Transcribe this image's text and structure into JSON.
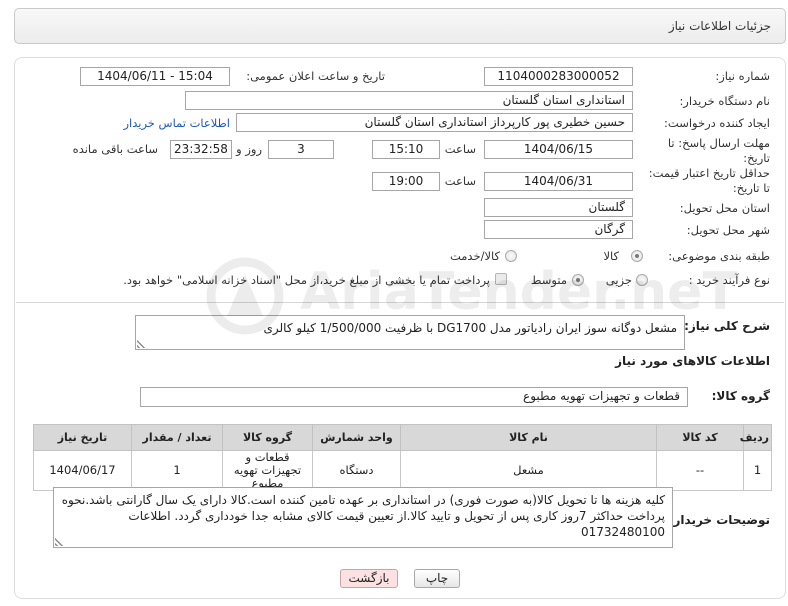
{
  "colors": {
    "link": "#1e5bb8",
    "back_button_bg": "#fbe1e1",
    "table_header_bg": "#d8d8d8",
    "header_bg": "#ececec"
  },
  "header": {
    "title": "جزئیات اطلاعات نیاز"
  },
  "form": {
    "need_number": {
      "label": "شماره نیاز:",
      "value": "1104000283000052"
    },
    "announce_datetime": {
      "label": "تاریخ و ساعت اعلان عمومی:",
      "value": "1404/06/11 - 15:04"
    },
    "buyer_org": {
      "label": "نام دستگاه خریدار:",
      "value": "استانداری استان گلستان"
    },
    "requester": {
      "label": "ایجاد کننده درخواست:",
      "value": "حسین خطیری پور کارپرداز استانداری استان گلستان",
      "contact_link": "اطلاعات تماس خریدار"
    },
    "response_deadline": {
      "label_line1": "مهلت ارسال پاسخ: تا",
      "label_line2": "تاریخ:",
      "date": "1404/06/15",
      "time_label": "ساعت",
      "time": "15:10",
      "days": "3",
      "days_label": "روز و",
      "remaining": "23:32:58",
      "remaining_label": "ساعت باقی مانده"
    },
    "price_validity": {
      "label_line1": "حداقل تاریخ اعتبار قیمت:",
      "label_line2": "تا تاریخ:",
      "date": "1404/06/31",
      "time_label": "ساعت",
      "time": "19:00"
    },
    "delivery_province": {
      "label": "استان محل تحویل:",
      "value": "گلستان"
    },
    "delivery_city": {
      "label": "شهر محل تحویل:",
      "value": "گرگان"
    },
    "category": {
      "label": "طبقه بندی موضوعی:",
      "options": [
        {
          "label": "کالا",
          "checked": true
        },
        {
          "label": "کالا/خدمت",
          "checked": false
        }
      ]
    },
    "purchase_type": {
      "label": "نوع فرآیند خرید :",
      "options": [
        {
          "label": "جزیی",
          "checked": false
        },
        {
          "label": "متوسط",
          "checked": true
        }
      ],
      "treasury_checkbox": {
        "label": "پرداخت تمام یا بخشی از مبلغ خرید،از محل \"اسناد خزانه اسلامی\" خواهد بود.",
        "checked": false
      }
    }
  },
  "description": {
    "label": "شرح کلی نیاز:",
    "value": "مشعل دوگانه سوز ایران رادیاتور مدل DG1700 با ظرفیت 1/500/000 کیلو کالری"
  },
  "goods": {
    "heading": "اطلاعات کالاهای مورد نیاز",
    "group_label": "گروه کالا:",
    "group_value": "قطعات و تجهیزات تهویه مطبوع",
    "columns": [
      "ردیف",
      "کد کالا",
      "نام کالا",
      "واحد شمارش",
      "گروه کالا",
      "تعداد / مقدار",
      "تاریخ نیاز"
    ],
    "rows": [
      [
        "1",
        "--",
        "مشعل",
        "دستگاه",
        "قطعات و تجهیزات تهویه مطبوع",
        "1",
        "1404/06/17"
      ]
    ]
  },
  "buyer_notes": {
    "label": "توضیحات خریدار:",
    "value": "کلیه هزینه ها تا تحویل کالا(به صورت فوری) در استانداری بر عهده تامین کننده است.کالا دارای یک سال گارانتی باشد.نحوه پرداخت حداکثر 7روز کاری پس از تحویل و تایید کالا.از تعیین قیمت کالای مشابه جدا خودداری گردد. اطلاعات 01732480100"
  },
  "buttons": {
    "print": "چاپ",
    "back": "بازگشت"
  },
  "watermark": {
    "text": "AriaTender.neT"
  }
}
